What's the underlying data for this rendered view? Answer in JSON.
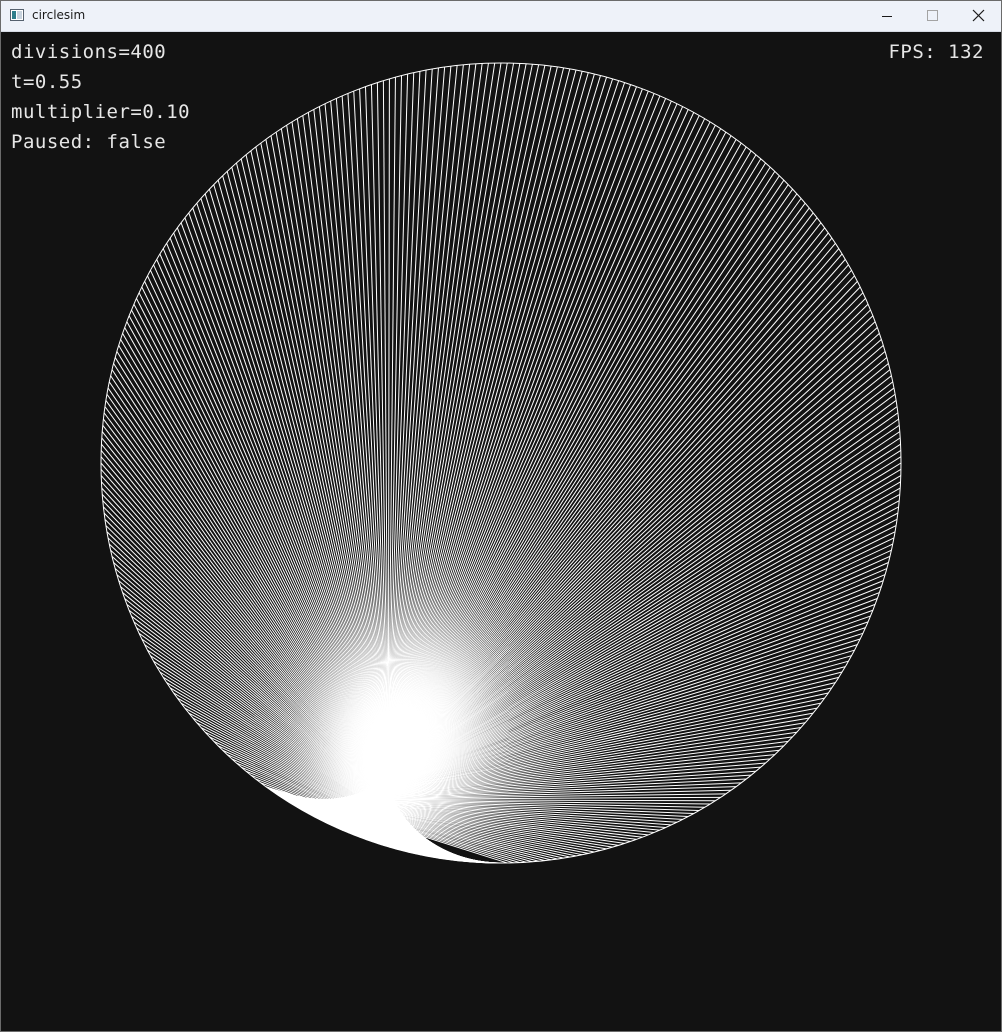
{
  "window": {
    "title": "circlesim",
    "icon": "app-window-icon",
    "controls": {
      "minimize_icon": "minimize-icon",
      "maximize_icon": "maximize-icon",
      "close_icon": "close-icon"
    }
  },
  "hud": {
    "divisions": "divisions=400",
    "t": "t=0.55",
    "multiplier": "multiplier=0.10",
    "paused": "Paused: false",
    "fps": "FPS: 132"
  },
  "simulation": {
    "divisions": 400,
    "multiplier": 0.1,
    "t": 0.55,
    "paused": false,
    "fps": 132,
    "background_color": "#121212",
    "line_color": "#ffffff"
  }
}
